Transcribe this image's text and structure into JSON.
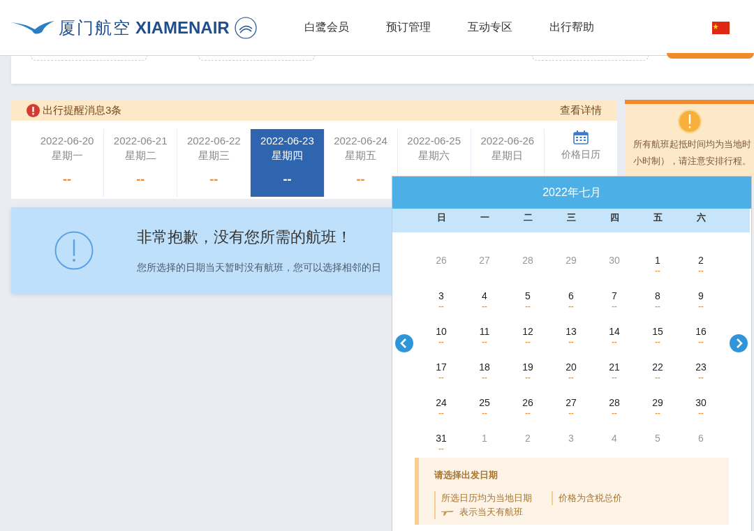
{
  "header": {
    "logo_cn": "厦门航空",
    "logo_en": "XIAMENAIR",
    "nav": [
      "白鹭会员",
      "预订管理",
      "互动专区",
      "出行帮助"
    ]
  },
  "alert_bar": {
    "message": "出行提醒消息3条",
    "link": "查看详情"
  },
  "dates": [
    {
      "date": "2022-06-20",
      "weekday": "星期一",
      "price": "--",
      "selected": false
    },
    {
      "date": "2022-06-21",
      "weekday": "星期二",
      "price": "--",
      "selected": false
    },
    {
      "date": "2022-06-22",
      "weekday": "星期三",
      "price": "--",
      "selected": false
    },
    {
      "date": "2022-06-23",
      "weekday": "星期四",
      "price": "--",
      "selected": true
    },
    {
      "date": "2022-06-24",
      "weekday": "星期五",
      "price": "--",
      "selected": false
    },
    {
      "date": "2022-06-25",
      "weekday": "星期六",
      "selected": false
    },
    {
      "date": "2022-06-26",
      "weekday": "星期日",
      "selected": false
    }
  ],
  "price_calendar_label": "价格日历",
  "notice": {
    "title": "非常抱歉，没有您所需的航班！",
    "text": "您所选择的日期当天暂时没有航班，您可以选择相邻的日"
  },
  "side_notice": {
    "lines": [
      "所有航班起抵时间均为当地时",
      "小时制），请注意安排行程。"
    ]
  },
  "calendar": {
    "title": "2022年七月",
    "weekdays": [
      "日",
      "一",
      "二",
      "三",
      "四",
      "五",
      "六"
    ],
    "days": [
      {
        "day": "26",
        "muted": true
      },
      {
        "day": "27",
        "muted": true
      },
      {
        "day": "28",
        "muted": true
      },
      {
        "day": "29",
        "muted": true
      },
      {
        "day": "30",
        "muted": true
      },
      {
        "day": "1",
        "muted": false,
        "price": "--"
      },
      {
        "day": "2",
        "muted": false,
        "price": "--"
      },
      {
        "day": "3",
        "muted": false,
        "price": "--"
      },
      {
        "day": "4",
        "muted": false,
        "price": "--"
      },
      {
        "day": "5",
        "muted": false,
        "price": "--"
      },
      {
        "day": "6",
        "muted": false,
        "price": "--"
      },
      {
        "day": "7",
        "muted": false,
        "price": "--"
      },
      {
        "day": "8",
        "muted": false,
        "price": "--"
      },
      {
        "day": "9",
        "muted": false,
        "price": "--"
      },
      {
        "day": "10",
        "muted": false,
        "price": "--"
      },
      {
        "day": "11",
        "muted": false,
        "price": "--"
      },
      {
        "day": "12",
        "muted": false,
        "price": "--"
      },
      {
        "day": "13",
        "muted": false,
        "price": "--"
      },
      {
        "day": "14",
        "muted": false,
        "price": "--"
      },
      {
        "day": "15",
        "muted": false,
        "price": "--"
      },
      {
        "day": "16",
        "muted": false,
        "price": "--"
      },
      {
        "day": "17",
        "muted": false,
        "price": "--"
      },
      {
        "day": "18",
        "muted": false,
        "price": "--"
      },
      {
        "day": "19",
        "muted": false,
        "price": "--"
      },
      {
        "day": "20",
        "muted": false,
        "price": "--"
      },
      {
        "day": "21",
        "muted": false,
        "price": "--"
      },
      {
        "day": "22",
        "muted": false,
        "price": "--"
      },
      {
        "day": "23",
        "muted": false,
        "price": "--"
      },
      {
        "day": "24",
        "muted": false,
        "price": "--"
      },
      {
        "day": "25",
        "muted": false,
        "price": "--"
      },
      {
        "day": "26",
        "muted": false,
        "price": "--"
      },
      {
        "day": "27",
        "muted": false,
        "price": "--"
      },
      {
        "day": "28",
        "muted": false,
        "price": "--"
      },
      {
        "day": "29",
        "muted": false,
        "price": "--"
      },
      {
        "day": "30",
        "muted": false,
        "price": "--"
      },
      {
        "day": "31",
        "muted": false,
        "price": "--"
      },
      {
        "day": "1",
        "muted": true
      },
      {
        "day": "2",
        "muted": true
      },
      {
        "day": "3",
        "muted": true
      },
      {
        "day": "4",
        "muted": true
      },
      {
        "day": "5",
        "muted": true
      },
      {
        "day": "6",
        "muted": true
      }
    ],
    "legend": {
      "title": "请选择出发日期",
      "items": [
        "所选日历均为当地日期",
        "价格为含税总价",
        "表示当天有航班"
      ]
    }
  }
}
